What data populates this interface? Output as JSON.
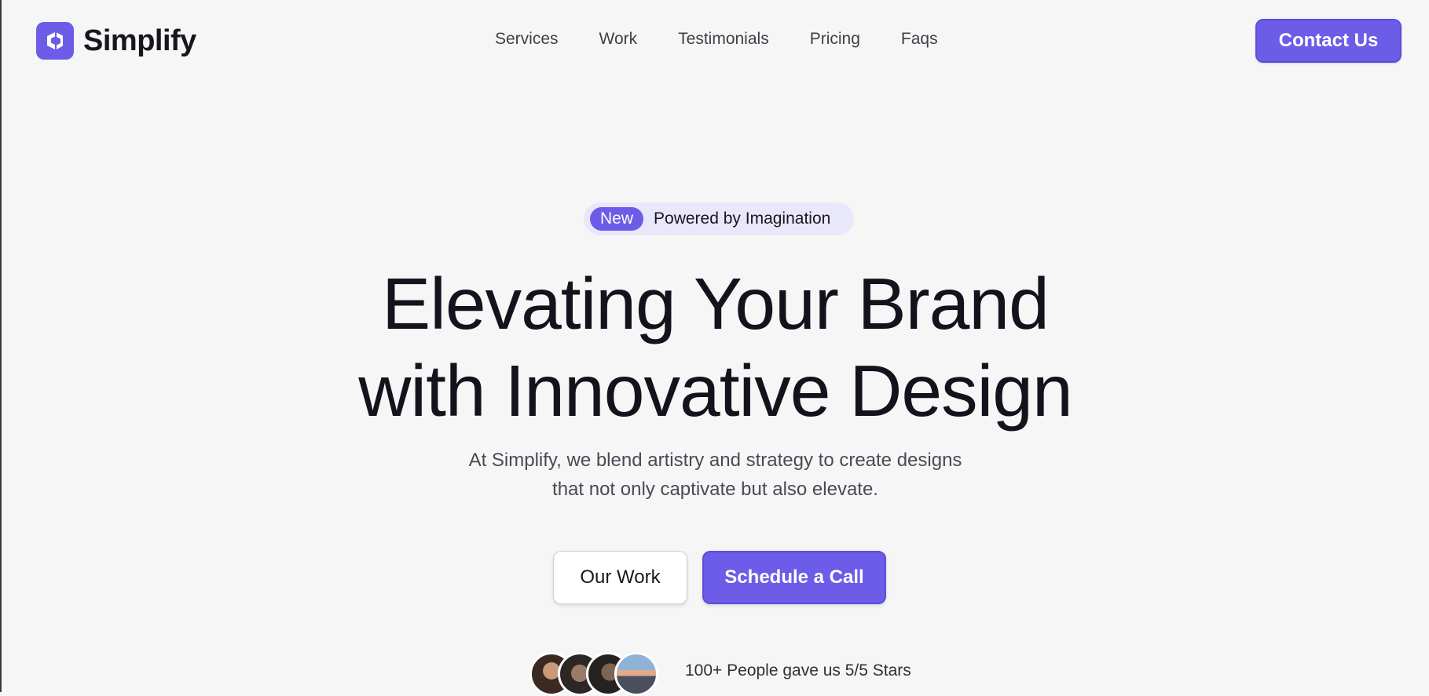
{
  "brand": {
    "name": "Simplify",
    "accent": "#6c5ce7"
  },
  "nav": {
    "items": [
      "Services",
      "Work",
      "Testimonials",
      "Pricing",
      "Faqs"
    ]
  },
  "header": {
    "contact_label": "Contact Us"
  },
  "hero": {
    "badge_new": "New",
    "badge_text": "Powered by Imagination",
    "headline_line1": "Elevating Your Brand",
    "headline_line2": "with Innovative Design",
    "subtext_line1": "At Simplify, we blend artistry and strategy to create designs",
    "subtext_line2": "that not only captivate but also elevate.",
    "secondary_button": "Our Work",
    "primary_button": "Schedule a Call"
  },
  "social_proof": {
    "text": "100+ People gave us 5/5 Stars",
    "avatars": [
      "avatar-1",
      "avatar-2",
      "avatar-3",
      "avatar-4"
    ]
  }
}
